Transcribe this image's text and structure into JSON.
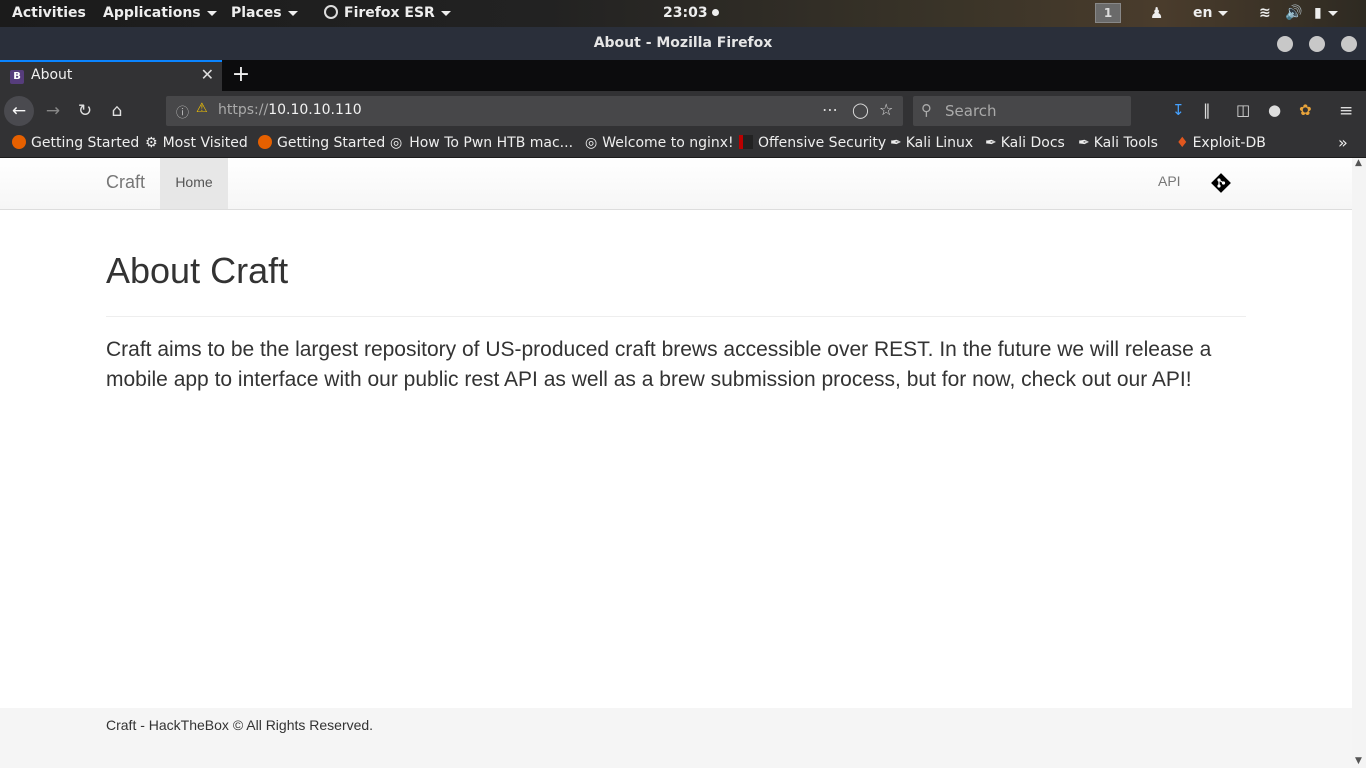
{
  "gnome": {
    "activities": "Activities",
    "applications": "Applications",
    "places": "Places",
    "app_menu": "Firefox ESR",
    "clock": "23:03",
    "workspace": "1",
    "lang": "en"
  },
  "window": {
    "title": "About - Mozilla Firefox"
  },
  "tab": {
    "label": "About",
    "favicon": "B"
  },
  "urlbar": {
    "scheme": "https://",
    "host": "10.10.10.110"
  },
  "search": {
    "placeholder": "Search"
  },
  "bookmarks": [
    {
      "label": "Getting Started"
    },
    {
      "label": "Most Visited"
    },
    {
      "label": "Getting Started"
    },
    {
      "label": "How To Pwn HTB mac..."
    },
    {
      "label": "Welcome to nginx!"
    },
    {
      "label": "Offensive Security"
    },
    {
      "label": "Kali Linux"
    },
    {
      "label": "Kali Docs"
    },
    {
      "label": "Kali Tools"
    },
    {
      "label": "Exploit-DB"
    }
  ],
  "site": {
    "brand": "Craft",
    "nav_home": "Home",
    "nav_api": "API",
    "heading": "About Craft",
    "lead": "Craft aims to be the largest repository of US-produced craft brews accessible over REST. In the future we will release a mobile app to interface with our public rest API as well as a brew submission process, but for now, check out our API!",
    "footer": "Craft - HackTheBox © All Rights Reserved."
  },
  "colors": {
    "accent": "#0a84ff",
    "bootstrap_purple": "#563d7c",
    "git_logo": "#000000"
  }
}
